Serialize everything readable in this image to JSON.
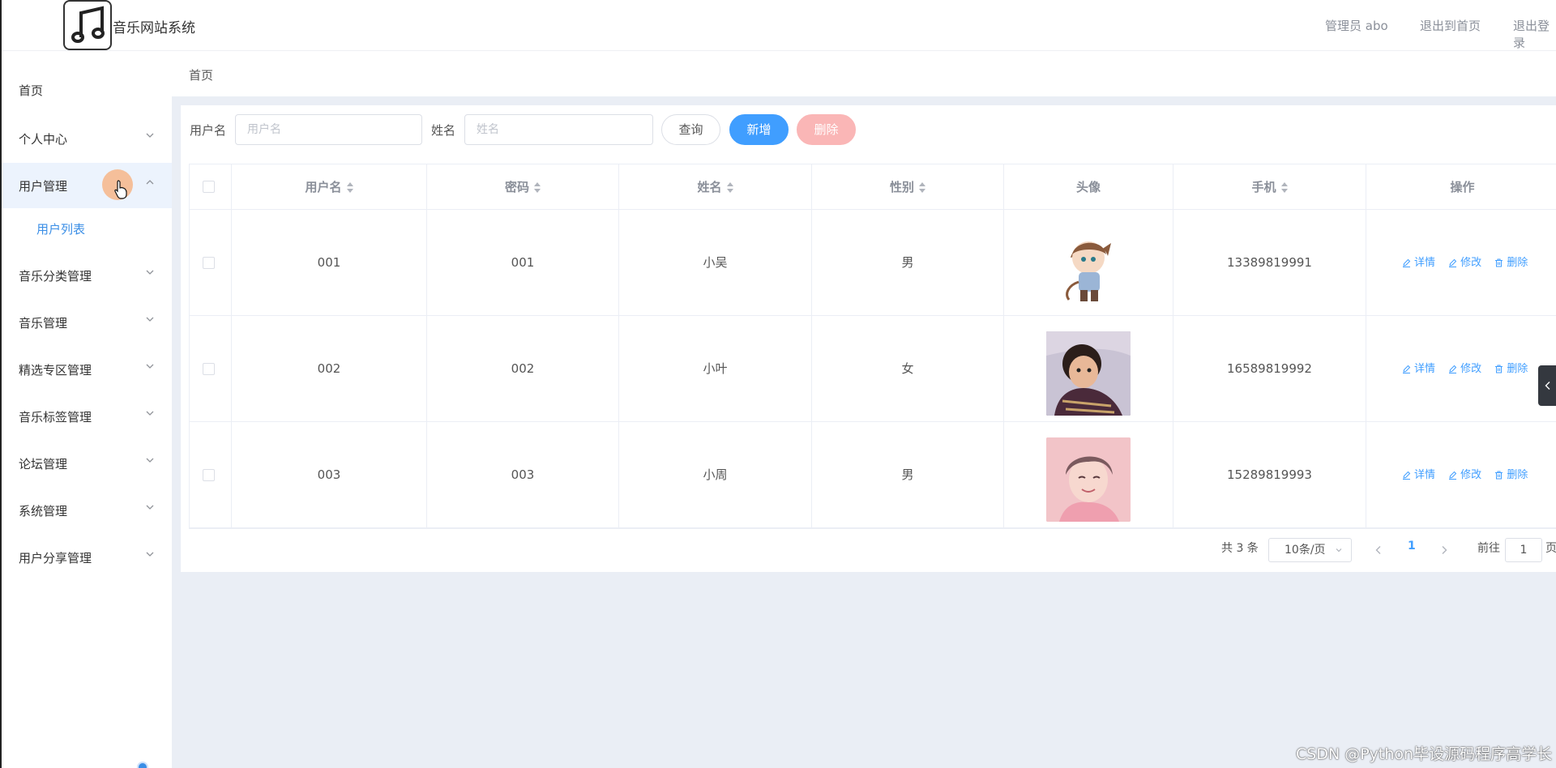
{
  "header": {
    "title": "音乐网站系统",
    "admin": "管理员 abo",
    "back_home": "退出到首页",
    "logout": "退出登录"
  },
  "sidebar": {
    "items": [
      {
        "label": "首页"
      },
      {
        "label": "个人中心"
      },
      {
        "label": "用户管理"
      },
      {
        "label": "音乐分类管理"
      },
      {
        "label": "音乐管理"
      },
      {
        "label": "精选专区管理"
      },
      {
        "label": "音乐标签管理"
      },
      {
        "label": "论坛管理"
      },
      {
        "label": "系统管理"
      },
      {
        "label": "用户分享管理"
      }
    ],
    "sub_item": "用户列表"
  },
  "breadcrumb": "首页",
  "search": {
    "username_label": "用户名",
    "username_placeholder": "用户名",
    "name_label": "姓名",
    "name_placeholder": "姓名",
    "query_btn": "查询",
    "add_btn": "新增",
    "delete_btn": "删除"
  },
  "table": {
    "columns": [
      "用户名",
      "密码",
      "姓名",
      "性别",
      "头像",
      "手机",
      "操作"
    ],
    "rows": [
      {
        "username": "001",
        "password": "001",
        "name": "小吴",
        "gender": "男",
        "phone": "13389819991"
      },
      {
        "username": "002",
        "password": "002",
        "name": "小叶",
        "gender": "女",
        "phone": "16589819992"
      },
      {
        "username": "003",
        "password": "003",
        "name": "小周",
        "gender": "男",
        "phone": "15289819993"
      }
    ],
    "actions": {
      "detail": "详情",
      "edit": "修改",
      "delete": "删除"
    }
  },
  "pagination": {
    "total": "共 3 条",
    "page_size": "10条/页",
    "current": "1",
    "goto": "前往",
    "goto_value": "1",
    "page_suffix": "页"
  },
  "watermark": "CSDN @Python毕设源码程序高学长"
}
